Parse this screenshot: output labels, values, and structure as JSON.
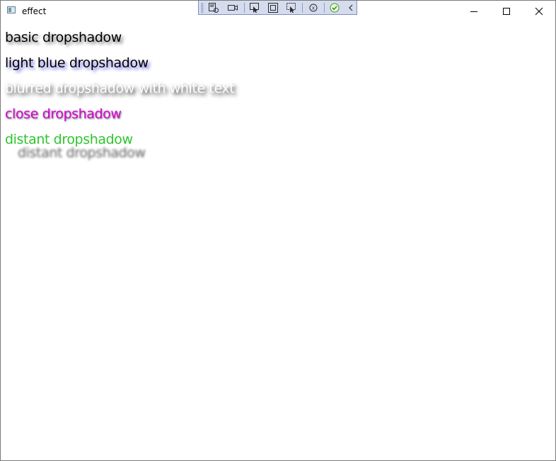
{
  "window": {
    "title": "effect"
  },
  "controls": {
    "minimize": "minimize-icon",
    "maximize": "maximize-icon",
    "close": "close-icon"
  },
  "debug_toolbar": {
    "icons": [
      "select-element-icon",
      "video-camera-icon",
      "pointer-select-icon",
      "layout-adorner-icon",
      "track-focus-icon",
      "hot-reload-icon",
      "check-icon",
      "collapse-chevron-icon"
    ],
    "accent": "#d4dcee"
  },
  "lines": [
    {
      "text": "basic dropshadow",
      "color": "#000000"
    },
    {
      "text": "light blue dropshadow",
      "color": "#000000"
    },
    {
      "text": "blurred dropshadow with white text",
      "color": "#ffffff"
    },
    {
      "text": "close dropshadow",
      "color": "#d400d4"
    },
    {
      "text": "distant dropshadow",
      "color": "#2ec52e"
    }
  ]
}
